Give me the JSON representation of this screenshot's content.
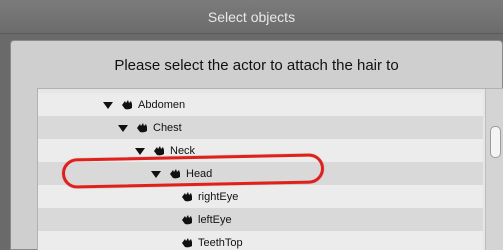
{
  "dialog": {
    "title": "Select objects",
    "prompt": "Please select the actor to attach the hair to"
  },
  "tree": {
    "items": [
      {
        "label": "Abdomen",
        "depth": 0,
        "expanded": true
      },
      {
        "label": "Chest",
        "depth": 1,
        "expanded": true
      },
      {
        "label": "Neck",
        "depth": 2,
        "expanded": true
      },
      {
        "label": "Head",
        "depth": 3,
        "expanded": true,
        "highlighted": true
      },
      {
        "label": "rightEye",
        "depth": 4,
        "expanded": false
      },
      {
        "label": "leftEye",
        "depth": 4,
        "expanded": false
      },
      {
        "label": "TeethTop",
        "depth": 4,
        "expanded": false
      }
    ]
  },
  "icons": {
    "expand": "triangle-down-icon",
    "actor": "hand-icon"
  },
  "colors": {
    "highlight_oval": "#e0211b",
    "titlebar_bg": "#6c6c6c",
    "panel_bg": "#cfcfcf"
  }
}
